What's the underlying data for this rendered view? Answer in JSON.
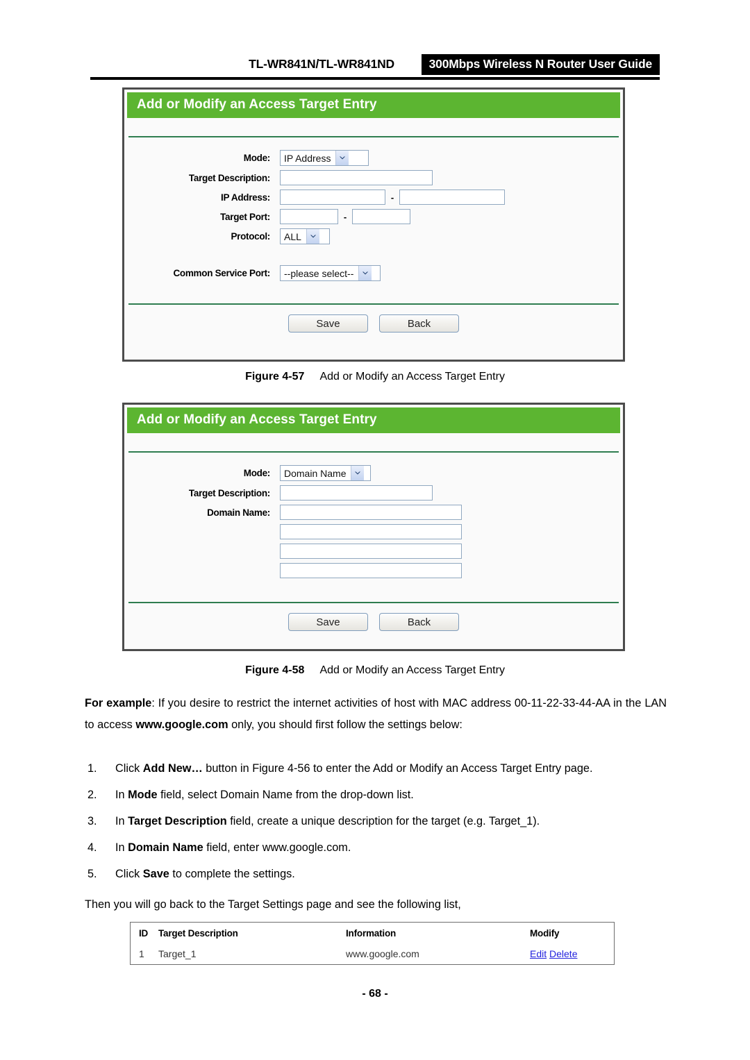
{
  "header": {
    "model": "TL-WR841N/TL-WR841ND",
    "product_title": "300Mbps Wireless N Router User Guide"
  },
  "panel_ip": {
    "title": "Add or Modify an Access Target Entry",
    "fields": {
      "mode_label": "Mode:",
      "mode_value": "IP Address",
      "target_description_label": "Target Description:",
      "target_description_value": "",
      "ip_address_label": "IP Address:",
      "ip_start_value": "",
      "ip_end_value": "",
      "range_dash": "-",
      "target_port_label": "Target Port:",
      "port_start_value": "",
      "port_end_value": "",
      "protocol_label": "Protocol:",
      "protocol_value": "ALL",
      "common_service_port_label": "Common Service Port:",
      "common_service_port_value": "--please select--"
    },
    "buttons": {
      "save": "Save",
      "back": "Back"
    }
  },
  "caption_457": {
    "number": "Figure 4-57",
    "text": "Add or Modify an Access Target Entry"
  },
  "panel_domain": {
    "title": "Add or Modify an Access Target Entry",
    "fields": {
      "mode_label": "Mode:",
      "mode_value": "Domain Name",
      "target_description_label": "Target Description:",
      "target_description_value": "",
      "domain_name_label": "Domain Name:",
      "domain_1_value": "",
      "domain_2_value": "",
      "domain_3_value": "",
      "domain_4_value": ""
    },
    "buttons": {
      "save": "Save",
      "back": "Back"
    }
  },
  "caption_458": {
    "number": "Figure 4-58",
    "text": "Add or Modify an Access Target Entry"
  },
  "body": {
    "example_lead": "For example",
    "example_p1": ": If you desire to restrict the internet activities of host with MAC address 00-11-22-33-44-AA in the LAN to access ",
    "example_link": "www.google.com",
    "example_p2": " only, you should first follow the settings below:",
    "steps": [
      {
        "num": "1.",
        "pre": "Click ",
        "bold": "Add New…",
        "post": " button in Figure 4-56 to enter the Add or Modify an Access Target Entry page."
      },
      {
        "num": "2.",
        "pre": "In ",
        "bold": "Mode",
        "post": " field, select Domain Name from the drop-down list."
      },
      {
        "num": "3.",
        "pre": "In ",
        "bold": "Target Description",
        "post": " field, create a unique description for the target (e.g. Target_1)."
      },
      {
        "num": "4.",
        "pre": "In ",
        "bold": "Domain Name",
        "post": " field, enter www.google.com."
      },
      {
        "num": "5.",
        "pre": "Click ",
        "bold": "Save",
        "post": " to complete the settings."
      }
    ],
    "then_text": "Then you will go back to the Target Settings page and see the following list,"
  },
  "result_table": {
    "columns": [
      "ID",
      "Target Description",
      "Information",
      "Modify"
    ],
    "rows": [
      {
        "id": "1",
        "description": "Target_1",
        "information": "www.google.com",
        "edit": "Edit",
        "delete": "Delete"
      }
    ]
  },
  "footer": {
    "page_number": "- 68 -"
  },
  "colors": {
    "panel_title_green": "#5cb531",
    "divider_green": "#2e7d4f",
    "panel_border": "#4c4c4c",
    "input_border": "#90a8c0",
    "link_blue": "#2222dd",
    "badge_black": "#000000"
  }
}
